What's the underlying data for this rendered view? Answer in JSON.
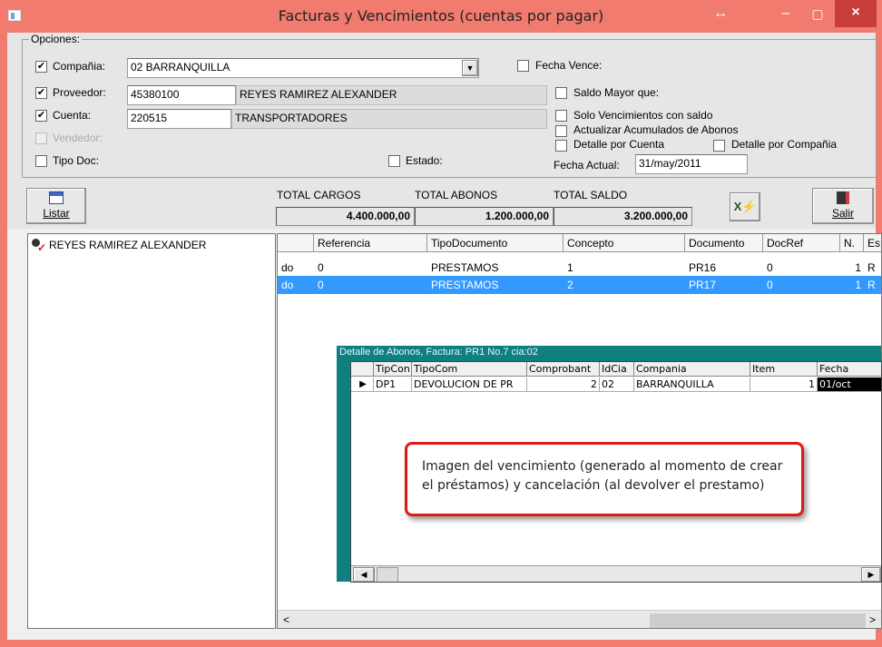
{
  "window": {
    "title": "Facturas y Vencimientos (cuentas por pagar)",
    "restore_symbol": "↔",
    "min_symbol": "–",
    "max_symbol": "▢",
    "close_symbol": "×"
  },
  "options": {
    "legend": "Opciones:",
    "compania": {
      "label": "Compañia:",
      "checked": true,
      "value": "02  BARRANQUILLA"
    },
    "proveedor": {
      "label": "Proveedor:",
      "checked": true,
      "code": "45380100",
      "name": "REYES RAMIREZ ALEXANDER"
    },
    "cuenta": {
      "label": "Cuenta:",
      "checked": true,
      "code": "220515",
      "name": "TRANSPORTADORES"
    },
    "vendedor": {
      "label": "Vendedor:",
      "checked": false
    },
    "tipo_doc": {
      "label": "Tipo Doc:",
      "checked": false
    },
    "estado": {
      "label": "Estado:",
      "checked": false
    },
    "fecha_vence": {
      "label": "Fecha Vence:",
      "checked": false
    },
    "saldo_mayor": {
      "label": "Saldo  Mayor que:",
      "checked": false
    },
    "solo_venc": {
      "label": "Solo Vencimientos con saldo",
      "checked": false
    },
    "actualizar": {
      "label": "Actualizar Acumulados de Abonos",
      "checked": false
    },
    "detalle_cuenta": {
      "label": "Detalle por Cuenta",
      "checked": false
    },
    "detalle_compania": {
      "label": "Detalle por Compañia",
      "checked": false
    },
    "fecha_actual": {
      "label": "Fecha Actual:",
      "value": "31/may/2011"
    }
  },
  "toolbar": {
    "listar": "Listar",
    "salir": "Salir"
  },
  "totals": {
    "cargos_label": "TOTAL CARGOS",
    "cargos": "4.400.000,00",
    "abonos_label": "TOTAL ABONOS",
    "abonos": "1.200.000,00",
    "saldo_label": "TOTAL SALDO",
    "saldo": "3.200.000,00"
  },
  "tree": {
    "items": [
      {
        "label": "REYES RAMIREZ ALEXANDER"
      }
    ]
  },
  "grid": {
    "headers": [
      "Referencia",
      "TipoDocumento",
      "Concepto",
      "Documento",
      "DocRef",
      "N.",
      "Es"
    ],
    "rows": [
      {
        "c0": "do",
        "referencia": "0",
        "tipo": "PRESTAMOS",
        "concepto": "1",
        "documento": "PR16",
        "docref": "0",
        "n": "1",
        "e": "R",
        "selected": false
      },
      {
        "c0": "do",
        "referencia": "0",
        "tipo": "PRESTAMOS",
        "concepto": "2",
        "documento": "PR17",
        "docref": "0",
        "n": "1",
        "e": "R",
        "selected": true
      }
    ]
  },
  "detail": {
    "title": "Detalle de Abonos, Factura: PR1 No.7 cia:02",
    "headers": [
      "TipCon",
      "TipoCom",
      "Comprobant",
      "IdCia",
      "Compania",
      "Item",
      "Fecha"
    ],
    "row": {
      "tipcon": "DP1",
      "tipocom": "DEVOLUCION DE PR",
      "comprobante": "2",
      "idcia": "02",
      "compania": "BARRANQUILLA",
      "item": "1",
      "fecha": "01/oct"
    }
  },
  "callout": {
    "text": "Imagen del vencimiento (generado al momento de crear el préstamos) y cancelación (al devolver el prestamo)"
  },
  "colors": {
    "titlebar": "#f07b6e",
    "selection": "#3399ff",
    "detail_frame": "#0f7f7f",
    "callout_border": "#e01818",
    "close_button": "#c83c3c"
  }
}
